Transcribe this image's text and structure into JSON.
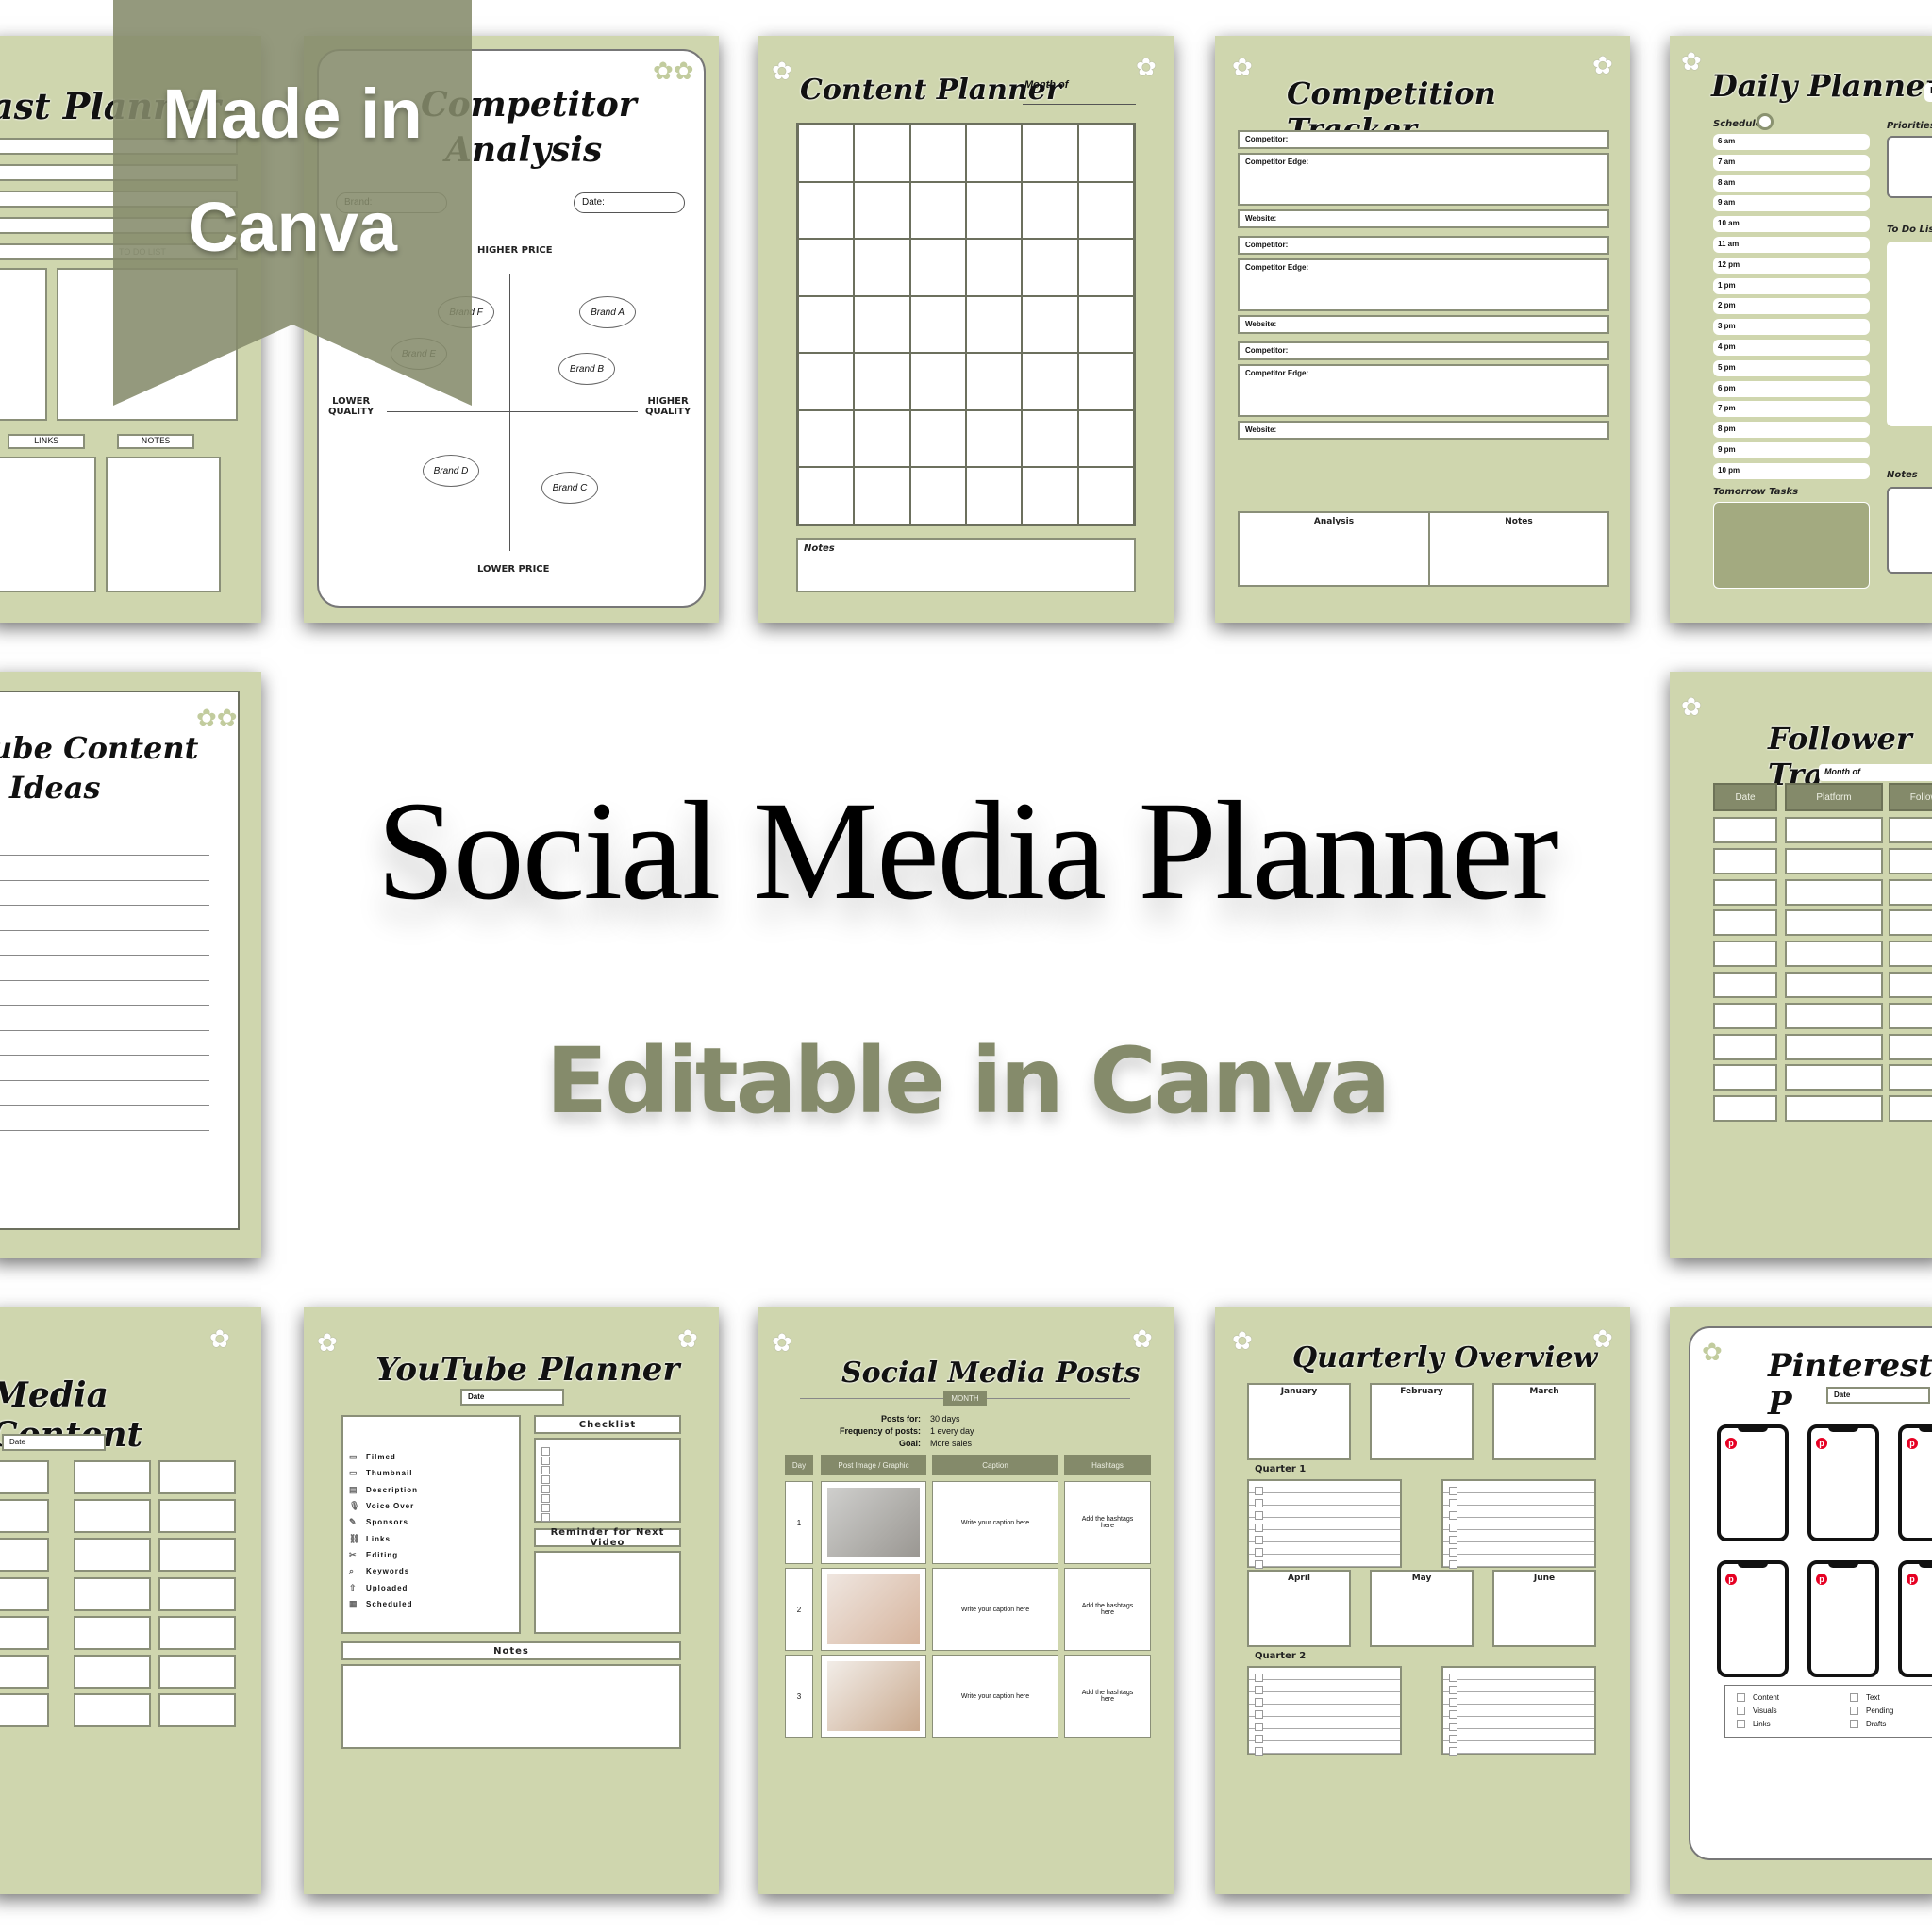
{
  "banner": {
    "line1": "Made in",
    "line2": "Canva",
    "color": "#858b6b"
  },
  "hero": {
    "title": "Social Media Planner",
    "subtitle": "Editable in Canva",
    "subtitle_color": "#858b6b"
  },
  "colors": {
    "page_green": "#cfd6ae",
    "olive": "#848a6a",
    "pinterest_red": "#e60023"
  },
  "podcast": {
    "title": "ast Planner",
    "todo": "TO DO LIST",
    "links": "LINKS",
    "notes": "NOTES"
  },
  "competitor": {
    "title1": "Competitor",
    "title2": "Analysis",
    "brand": "Brand:",
    "date": "Date:",
    "higher_price": "HIGHER PRICE",
    "lower_price": "LOWER PRICE",
    "lower_quality": "LOWER\nQUALITY",
    "higher_quality": "HIGHER\nQUALITY",
    "brands": [
      "Brand A",
      "Brand B",
      "Brand C",
      "Brand D",
      "Brand E",
      "Brand F"
    ]
  },
  "content_planner": {
    "title": "Content Planner",
    "month_of": "Month of",
    "notes": "Notes"
  },
  "competition_tracker": {
    "title": "Competition Tracker",
    "competitor": "Competitor:",
    "edge": "Competitor Edge:",
    "website": "Website:",
    "analysis": "Analysis",
    "notes": "Notes"
  },
  "daily_planner": {
    "title": "Daily Planner",
    "date_stub": "D",
    "schedule": "Schedule",
    "priorities": "Priorities",
    "todo": "To Do List",
    "notes": "Notes",
    "tomorrow": "Tomorrow Tasks",
    "hours": [
      "6 am",
      "7 am",
      "8 am",
      "9 am",
      "10 am",
      "11 am",
      "12 pm",
      "1 pm",
      "2 pm",
      "3 pm",
      "4 pm",
      "5 pm",
      "6 pm",
      "7 pm",
      "8 pm",
      "9 pm",
      "10 pm"
    ]
  },
  "yt_ideas": {
    "title1": "ube Content",
    "title2": "Ideas"
  },
  "follower_tracker": {
    "title": "Follower Tra",
    "month_of": "Month of",
    "headers": [
      "Date",
      "Platform",
      "Followe"
    ]
  },
  "media_content": {
    "title": "Media Content",
    "date": "Date"
  },
  "yt_planner": {
    "title": "YouTube Planner",
    "date": "Date",
    "checklist": "Checklist",
    "reminder": "Reminder for Next Video",
    "notes": "Notes",
    "steps": [
      "Filmed",
      "Thumbnail",
      "Description",
      "Voice Over",
      "Sponsors",
      "Links",
      "Editing",
      "Keywords",
      "Uploaded",
      "Scheduled"
    ]
  },
  "sm_posts": {
    "title": "Social Media Posts",
    "month": "MONTH",
    "posts_for_label": "Posts for:",
    "posts_for": "30 days",
    "freq_label": "Frequency of posts:",
    "freq": "1 every day",
    "goal_label": "Goal:",
    "goal": "More sales",
    "headers": [
      "Day",
      "Post Image / Graphic",
      "Caption",
      "Hashtags"
    ],
    "rows": [
      {
        "day": "1",
        "caption": "Write your caption here",
        "hashtags": "Add the hashtags here"
      },
      {
        "day": "2",
        "caption": "Write your caption here",
        "hashtags": "Add the hashtags here"
      },
      {
        "day": "3",
        "caption": "Write your caption here",
        "hashtags": "Add the hashtags here"
      }
    ]
  },
  "quarterly": {
    "title": "Quarterly Overview",
    "months_q1": [
      "January",
      "February",
      "March"
    ],
    "months_q2": [
      "April",
      "May",
      "June"
    ],
    "q1": "Quarter 1",
    "q2": "Quarter 2"
  },
  "pinterest": {
    "title": "Pinterest P",
    "date": "Date",
    "checks": [
      "Content",
      "Visuals",
      "Links",
      "Text",
      "Pending",
      "Drafts"
    ]
  }
}
